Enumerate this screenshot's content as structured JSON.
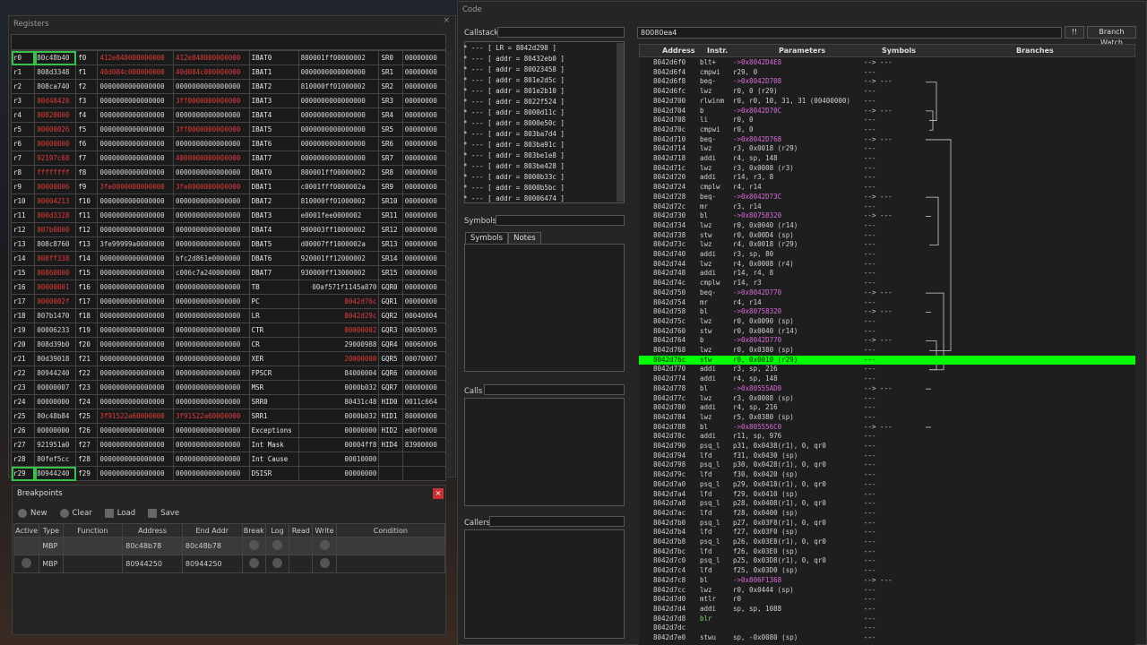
{
  "registers": {
    "title": "Registers",
    "close": "×",
    "rows": [
      [
        "r0",
        "80c48b40",
        0,
        "f0",
        "412e848000000000",
        1,
        "412e848000000000",
        1,
        "IBAT0",
        "800001ff00000002",
        "SR0",
        "00000000"
      ],
      [
        "r1",
        "808d3348",
        0,
        "f1",
        "40d084c000000000",
        1,
        "40d084c000000000",
        1,
        "IBAT1",
        "0000000000000000",
        "SR1",
        "00000000"
      ],
      [
        "r2",
        "808ca740",
        0,
        "f2",
        "0000000000000000",
        0,
        "0000000000000000",
        0,
        "IBAT2",
        "810000ff01000002",
        "SR2",
        "00000000"
      ],
      [
        "r3",
        "80d48420",
        1,
        "f3",
        "0000000000000000",
        0,
        "3ff0000000000000",
        1,
        "IBAT3",
        "0000000000000000",
        "SR3",
        "00000000"
      ],
      [
        "r4",
        "80820000",
        1,
        "f4",
        "0000000000000000",
        0,
        "0000000000000000",
        0,
        "IBAT4",
        "0000000000000000",
        "SR4",
        "00000000"
      ],
      [
        "r5",
        "00000026",
        1,
        "f5",
        "0000000000000000",
        0,
        "3ff0000000000000",
        1,
        "IBAT5",
        "0000000000000000",
        "SR5",
        "00000000"
      ],
      [
        "r6",
        "00000000",
        1,
        "f6",
        "0000000000000000",
        0,
        "0000000000000000",
        0,
        "IBAT6",
        "0000000000000000",
        "SR6",
        "00000000"
      ],
      [
        "r7",
        "92197c68",
        1,
        "f7",
        "0000000000000000",
        0,
        "4000000000000000",
        1,
        "IBAT7",
        "0000000000000000",
        "SR7",
        "00000000"
      ],
      [
        "r8",
        "ffffffff",
        1,
        "f8",
        "0000000000000000",
        0,
        "0000000000000000",
        0,
        "DBAT0",
        "800001ff00000002",
        "SR8",
        "00000000"
      ],
      [
        "r9",
        "00000006",
        1,
        "f9",
        "3fe0000000000000",
        1,
        "3fe0000000000000",
        1,
        "DBAT1",
        "c0001fff0000002a",
        "SR9",
        "00000000"
      ],
      [
        "r10",
        "00004213",
        1,
        "f10",
        "0000000000000000",
        0,
        "0000000000000000",
        0,
        "DBAT2",
        "810000ff01000002",
        "SR10",
        "00000000"
      ],
      [
        "r11",
        "800d3328",
        1,
        "f11",
        "0000000000000000",
        0,
        "0000000000000000",
        0,
        "DBAT3",
        "e0001fee0000002",
        "SR11",
        "00000000"
      ],
      [
        "r12",
        "807b0000",
        1,
        "f12",
        "0000000000000000",
        0,
        "0000000000000000",
        0,
        "DBAT4",
        "900003ff10000002",
        "SR12",
        "00000000"
      ],
      [
        "r13",
        "808c8760",
        0,
        "f13",
        "3fe99999a0000000",
        0,
        "0000000000000000",
        0,
        "DBAT5",
        "d00007ff1000002a",
        "SR13",
        "00000000"
      ],
      [
        "r14",
        "808ff338",
        1,
        "f14",
        "0000000000000000",
        0,
        "bfc2d861e0000000",
        0,
        "DBAT6",
        "920001ff12000002",
        "SR14",
        "00000000"
      ],
      [
        "r15",
        "80860000",
        1,
        "f15",
        "0000000000000000",
        0,
        "c006c7a240000000",
        0,
        "DBAT7",
        "930000ff13000002",
        "SR15",
        "00000000"
      ],
      [
        "r16",
        "00000001",
        1,
        "f16",
        "0000000000000000",
        0,
        "0000000000000000",
        0,
        "TB",
        "00af571f1145a870",
        "GQR0",
        "00000000"
      ],
      [
        "r17",
        "0000002f",
        1,
        "f17",
        "0000000000000000",
        0,
        "0000000000000000",
        0,
        "PC",
        "8042d76c",
        "GQR1",
        "00000000"
      ],
      [
        "r18",
        "807b1470",
        0,
        "f18",
        "0000000000000000",
        0,
        "0000000000000000",
        0,
        "LR",
        "8042d29c",
        "GQR2",
        "00040004"
      ],
      [
        "r19",
        "00006233",
        0,
        "f19",
        "0000000000000000",
        0,
        "0000000000000000",
        0,
        "CTR",
        "00000002",
        "GQR3",
        "00050005"
      ],
      [
        "r20",
        "808d39b0",
        0,
        "f20",
        "0000000000000000",
        0,
        "0000000000000000",
        0,
        "CR",
        "29000988",
        "GQR4",
        "00060006"
      ],
      [
        "r21",
        "80d39018",
        0,
        "f21",
        "0000000000000000",
        0,
        "0000000000000000",
        0,
        "XER",
        "20000000",
        "GQR5",
        "00070007"
      ],
      [
        "r22",
        "80944240",
        0,
        "f22",
        "0000000000000000",
        0,
        "0000000000000000",
        0,
        "FPSCR",
        "84000004",
        "GQR6",
        "00000000"
      ],
      [
        "r23",
        "00000007",
        0,
        "f23",
        "0000000000000000",
        0,
        "0000000000000000",
        0,
        "MSR",
        "0000b032",
        "GQR7",
        "00000000"
      ],
      [
        "r24",
        "00000000",
        0,
        "f24",
        "0000000000000000",
        0,
        "0000000000000000",
        0,
        "SRR0",
        "80431c48",
        "HID0",
        "0011c664"
      ],
      [
        "r25",
        "80c48b84",
        0,
        "f25",
        "3f91522a60000000",
        1,
        "3f91522a60000000",
        1,
        "SRR1",
        "0000b032",
        "HID1",
        "80000000"
      ],
      [
        "r26",
        "00000000",
        0,
        "f26",
        "0000000000000000",
        0,
        "0000000000000000",
        0,
        "Exceptions",
        "00000000",
        "HID2",
        "e00f0000"
      ],
      [
        "r27",
        "921951a0",
        0,
        "f27",
        "0000000000000000",
        0,
        "0000000000000000",
        0,
        "Int Mask",
        "00004ff8",
        "HID4",
        "83900000"
      ],
      [
        "r28",
        "80fef5cc",
        0,
        "f28",
        "0000000000000000",
        0,
        "0000000000000000",
        0,
        "Int Cause",
        "00010000",
        "",
        ""
      ],
      [
        "r29",
        "80944240",
        0,
        "f29",
        "0000000000000000",
        0,
        "0000000000000000",
        0,
        "DSISR",
        "00000000",
        "",
        ""
      ]
    ]
  },
  "breakpoints": {
    "title": "Breakpoints",
    "close": "×",
    "new": "New",
    "clear": "Clear",
    "load": "Load",
    "save": "Save",
    "columns": [
      "Active",
      "Type",
      "Function",
      "Address",
      "End Addr",
      "Break",
      "Log",
      "Read",
      "Write",
      "Condition"
    ],
    "rows": [
      [
        "",
        "MBP",
        "",
        "80c48b78",
        "80c48b78"
      ],
      [
        "",
        "MBP",
        "",
        "80944250",
        "80944250"
      ]
    ]
  },
  "code": {
    "title": "Code",
    "address": "80080ea4",
    "pause": "!!",
    "branch_watch": "Branch Watch",
    "callstack_label": "Callstack",
    "symbols_label": "Symbols",
    "calls_label": "Calls",
    "callers_label": "Callers",
    "tabs": [
      "Symbols",
      "Notes"
    ],
    "callstack": [
      "* --- [ LR = 8042d298 ]",
      "* --- [ addr = 80432eb0 ]",
      "* --- [ addr = 80023458 ]",
      "* --- [ addr = 801e2d5c ]",
      "* --- [ addr = 801e2b10 ]",
      "* --- [ addr = 8022f524 ]",
      "* --- [ addr = 8000d11c ]",
      "* --- [ addr = 8000e50c ]",
      "* --- [ addr = 803ba7d4 ]",
      "* --- [ addr = 803ba91c ]",
      "* --- [ addr = 803be1e8 ]",
      "* --- [ addr = 803be428 ]",
      "* --- [ addr = 8000b33c ]",
      "* --- [ addr = 8000b5bc ]",
      "* --- [ addr = 80006474 ]"
    ],
    "columns": [
      "Address",
      "Instr.",
      "Parameters",
      "Symbols",
      "Branches"
    ],
    "lines": [
      [
        "8042d6f0",
        "blt+",
        "->0x8042D4E8",
        "--> ---"
      ],
      [
        "8042d6f4",
        "cmpwi",
        "r29, 0",
        "---"
      ],
      [
        "8042d6f8",
        "beq-",
        "->0x8042D708",
        "--> ---"
      ],
      [
        "8042d6fc",
        "lwz",
        "r0, 0 (r29)",
        "---"
      ],
      [
        "8042d700",
        "rlwinm",
        "r0, r0, 10, 31, 31 (00400000)",
        "---"
      ],
      [
        "8042d704",
        "b",
        "->0x8042D70C",
        "--> ---"
      ],
      [
        "8042d708",
        "li",
        "r0, 0",
        "---"
      ],
      [
        "8042d70c",
        "cmpwi",
        "r0, 0",
        "---"
      ],
      [
        "8042d710",
        "beq-",
        "->0x8042D768",
        "--> ---"
      ],
      [
        "8042d714",
        "lwz",
        "r3, 0x0018 (r29)",
        "---"
      ],
      [
        "8042d718",
        "addi",
        "r4, sp, 148",
        "---"
      ],
      [
        "8042d71c",
        "lwz",
        "r3, 0x0008 (r3)",
        "---"
      ],
      [
        "8042d720",
        "addi",
        "r14, r3, 8",
        "---"
      ],
      [
        "8042d724",
        "cmplw",
        "r4, r14",
        "---"
      ],
      [
        "8042d728",
        "beq-",
        "->0x8042D73C",
        "--> ---"
      ],
      [
        "8042d72c",
        "mr",
        "r3, r14",
        "---"
      ],
      [
        "8042d730",
        "bl",
        "->0x80758320",
        "--> ---"
      ],
      [
        "8042d734",
        "lwz",
        "r0, 0x0040 (r14)",
        "---"
      ],
      [
        "8042d738",
        "stw",
        "r0, 0x00D4 (sp)",
        "---"
      ],
      [
        "8042d73c",
        "lwz",
        "r4, 0x0018 (r29)",
        "---"
      ],
      [
        "8042d740",
        "addi",
        "r3, sp, 80",
        "---"
      ],
      [
        "8042d744",
        "lwz",
        "r4, 0x0008 (r4)",
        "---"
      ],
      [
        "8042d748",
        "addi",
        "r14, r4, 8",
        "---"
      ],
      [
        "8042d74c",
        "cmplw",
        "r14, r3",
        "---"
      ],
      [
        "8042d750",
        "beq-",
        "->0x8042D770",
        "--> ---"
      ],
      [
        "8042d754",
        "mr",
        "r4, r14",
        "---"
      ],
      [
        "8042d758",
        "bl",
        "->0x80758320",
        "--> ---"
      ],
      [
        "8042d75c",
        "lwz",
        "r0, 0x0090 (sp)",
        "---"
      ],
      [
        "8042d760",
        "stw",
        "r0, 0x0040 (r14)",
        "---"
      ],
      [
        "8042d764",
        "b",
        "->0x8042D770",
        "--> ---"
      ],
      [
        "8042d768",
        "lwz",
        "r0, 0x0380 (sp)",
        "---"
      ],
      [
        "8042d76c",
        "stw",
        "r0, 0x0010 (r29)",
        "---"
      ],
      [
        "8042d770",
        "addi",
        "r3, sp, 216",
        "---"
      ],
      [
        "8042d774",
        "addi",
        "r4, sp, 148",
        "---"
      ],
      [
        "8042d778",
        "bl",
        "->0x80555AD0",
        "--> ---"
      ],
      [
        "8042d77c",
        "lwz",
        "r3, 0x0008 (sp)",
        "---"
      ],
      [
        "8042d780",
        "addi",
        "r4, sp, 216",
        "---"
      ],
      [
        "8042d784",
        "lwz",
        "r5, 0x0380 (sp)",
        "---"
      ],
      [
        "8042d788",
        "bl",
        "->0x805556C0",
        "--> ---"
      ],
      [
        "8042d78c",
        "addi",
        "r11, sp, 976",
        "---"
      ],
      [
        "8042d790",
        "psq_l",
        "p31, 0x0438(r1), 0, qr0",
        "---"
      ],
      [
        "8042d794",
        "lfd",
        "f31, 0x0430 (sp)",
        "---"
      ],
      [
        "8042d798",
        "psq_l",
        "p30, 0x0428(r1), 0, qr0",
        "---"
      ],
      [
        "8042d79c",
        "lfd",
        "f30, 0x0420 (sp)",
        "---"
      ],
      [
        "8042d7a0",
        "psq_l",
        "p29, 0x0418(r1), 0, qr0",
        "---"
      ],
      [
        "8042d7a4",
        "lfd",
        "f29, 0x0410 (sp)",
        "---"
      ],
      [
        "8042d7a8",
        "psq_l",
        "p28, 0x0408(r1), 0, qr0",
        "---"
      ],
      [
        "8042d7ac",
        "lfd",
        "f28, 0x0400 (sp)",
        "---"
      ],
      [
        "8042d7b0",
        "psq_l",
        "p27, 0x03F8(r1), 0, qr0",
        "---"
      ],
      [
        "8042d7b4",
        "lfd",
        "f27, 0x03F0 (sp)",
        "---"
      ],
      [
        "8042d7b8",
        "psq_l",
        "p26, 0x03E8(r1), 0, qr0",
        "---"
      ],
      [
        "8042d7bc",
        "lfd",
        "f26, 0x03E0 (sp)",
        "---"
      ],
      [
        "8042d7c0",
        "psq_l",
        "p25, 0x03D8(r1), 0, qr0",
        "---"
      ],
      [
        "8042d7c4",
        "lfd",
        "f25, 0x03D0 (sp)",
        "---"
      ],
      [
        "8042d7c8",
        "bl",
        "->0x806F1368",
        "--> ---"
      ],
      [
        "8042d7cc",
        "lwz",
        "r0, 0x0444 (sp)",
        "---"
      ],
      [
        "8042d7d0",
        "mtlr",
        "r0",
        "---"
      ],
      [
        "8042d7d4",
        "addi",
        "sp, sp, 1088",
        "---"
      ],
      [
        "8042d7d8",
        "blr",
        "",
        "---"
      ],
      [
        "8042d7dc",
        "",
        "",
        "---"
      ],
      [
        "8042d7e0",
        "stwu",
        "sp, -0x0080 (sp)",
        "---"
      ]
    ],
    "highlight_address": "8042d76c"
  },
  "colors": {
    "red": "#e23b3b",
    "green": "#00ff00",
    "target": "#d96bd9"
  }
}
